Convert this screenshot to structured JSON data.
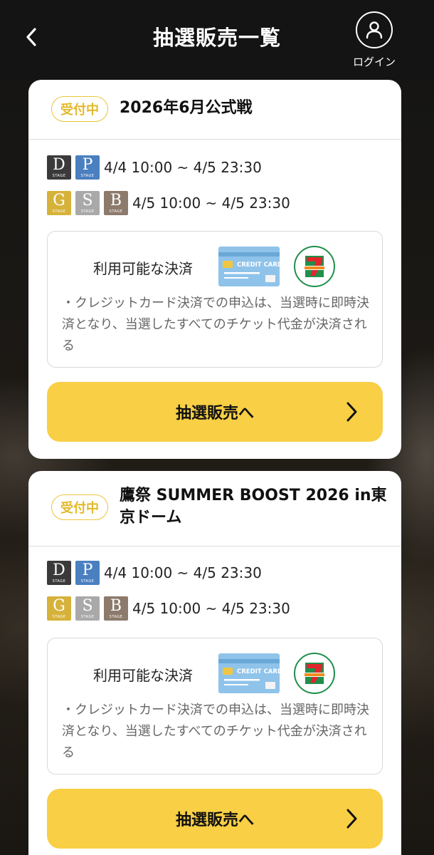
{
  "header": {
    "title": "抽選販売一覧",
    "login_label": "ログイン"
  },
  "stage_icons": {
    "D": {
      "letter": "D",
      "sub": "STAGE",
      "color": "#3a3a3a"
    },
    "P": {
      "letter": "P",
      "sub": "STAGE",
      "color": "#4a7fc0"
    },
    "G": {
      "letter": "G",
      "sub": "STAGE",
      "color": "#d6b23a"
    },
    "S": {
      "letter": "S",
      "sub": "STAGE",
      "color": "#a9a9a9"
    },
    "B": {
      "letter": "B",
      "sub": "STAGE",
      "color": "#8c7a6c"
    }
  },
  "cards": [
    {
      "status": "受付中",
      "title": "2026年6月公式戦",
      "schedule": [
        {
          "stages": [
            "D",
            "P"
          ],
          "period": "4/4 10:00 ~ 4/5 23:30"
        },
        {
          "stages": [
            "G",
            "S",
            "B"
          ],
          "period": "4/5 10:00 ~ 4/5 23:30"
        }
      ],
      "payment": {
        "label": "利用可能な決済",
        "methods": [
          "credit-card-icon",
          "seven-eleven-icon"
        ],
        "card_text": "CREDIT CARD",
        "note": "・クレジットカード決済での申込は、当選時に即時決済となり、当選したすべてのチケット代金が決済される"
      },
      "cta": "抽選販売へ"
    },
    {
      "status": "受付中",
      "title": "鷹祭 SUMMER BOOST 2026 in東京ドーム",
      "schedule": [
        {
          "stages": [
            "D",
            "P"
          ],
          "period": "4/4 10:00 ~ 4/5 23:30"
        },
        {
          "stages": [
            "G",
            "S",
            "B"
          ],
          "period": "4/5 10:00 ~ 4/5 23:30"
        }
      ],
      "payment": {
        "label": "利用可能な決済",
        "methods": [
          "credit-card-icon",
          "seven-eleven-icon"
        ],
        "card_text": "CREDIT CARD",
        "note": "・クレジットカード決済での申込は、当選時に即時決済となり、当選したすべてのチケット代金が決済される"
      },
      "cta": "抽選販売へ"
    }
  ]
}
